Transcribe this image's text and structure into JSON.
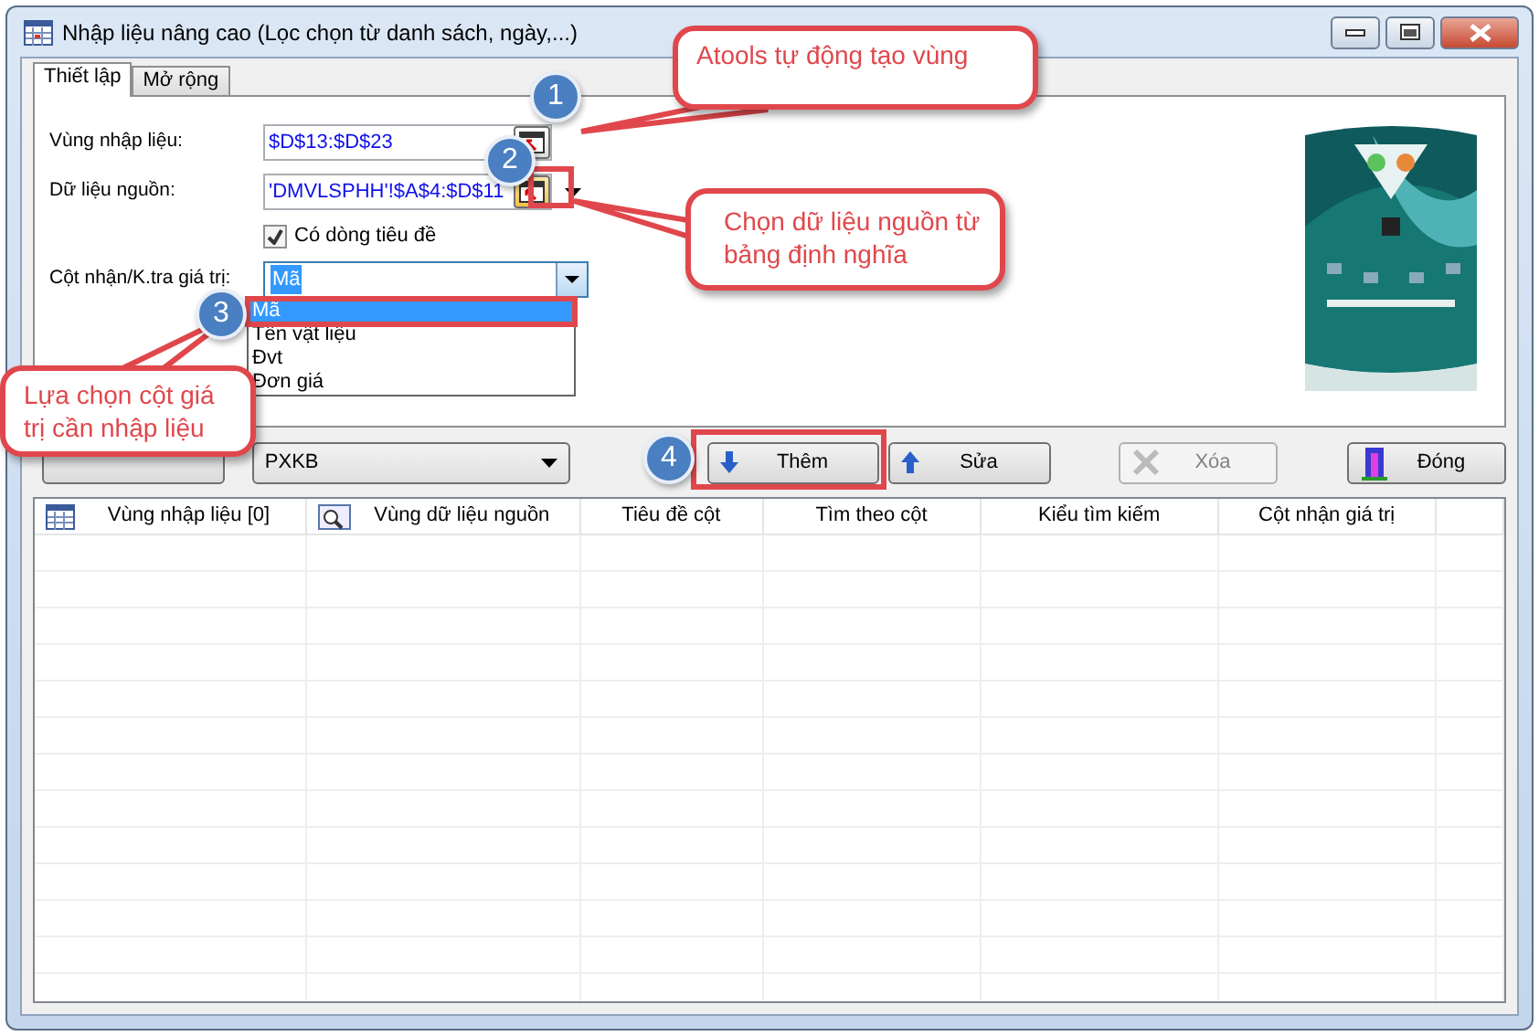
{
  "window": {
    "title": "Nhập liệu nâng cao (Lọc chọn từ danh sách, ngày,...)"
  },
  "tabs": [
    {
      "label": "Thiết lập",
      "selected": true
    },
    {
      "label": "Mở rộng",
      "selected": false
    }
  ],
  "form": {
    "input_range": {
      "label": "Vùng nhập liệu:",
      "value": "$D$13:$D$23"
    },
    "source": {
      "label": "Dữ liệu nguồn:",
      "value": "'DMVLSPHH'!$A$4:$D$11"
    },
    "has_header": {
      "label": "Có dòng tiêu đề",
      "checked": true
    },
    "column": {
      "label": "Cột nhận/K.tra giá trị:",
      "value": "Mã",
      "expanded": true,
      "options": [
        {
          "label": "Mã",
          "selected": true
        },
        {
          "label": "Tên vật liệu",
          "selected": false
        },
        {
          "label": "Đvt",
          "selected": false
        },
        {
          "label": "Đơn giá",
          "selected": false
        }
      ]
    }
  },
  "sheet_select": {
    "value": "PXKB"
  },
  "buttons": [
    {
      "label": "Thêm",
      "kind": "add",
      "disabled": false
    },
    {
      "label": "Sửa",
      "kind": "edit",
      "disabled": false
    },
    {
      "label": "Xóa",
      "kind": "delete",
      "disabled": true
    },
    {
      "label": "Đóng",
      "kind": "close",
      "disabled": false
    }
  ],
  "table": {
    "columns": [
      {
        "label": "Vùng nhập liệu [0]",
        "kind": "grid"
      },
      {
        "label": "Vùng dữ liệu nguồn",
        "kind": "search"
      },
      {
        "label": "Tiêu đề cột"
      },
      {
        "label": "Tìm theo cột"
      },
      {
        "label": "Kiểu tìm kiếm"
      },
      {
        "label": "Cột nhận giá trị"
      }
    ]
  },
  "steps": [
    "1",
    "2",
    "3",
    "4"
  ],
  "callouts": [
    {
      "text": "Atools tự động tạo vùng"
    },
    {
      "text": "Chọn dữ liệu nguồn từ bảng định nghĩa"
    },
    {
      "text": "Lựa chọn cột giá trị cần nhập liệu"
    }
  ]
}
